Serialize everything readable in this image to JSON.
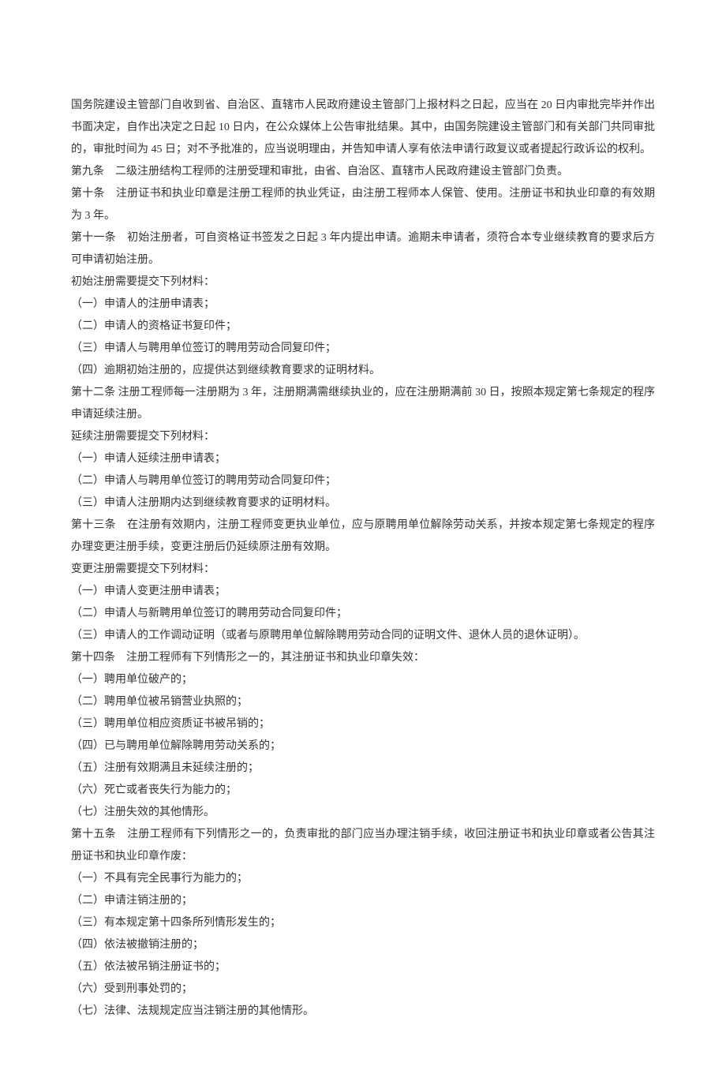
{
  "paragraphs": [
    "国务院建设主管部门自收到省、自治区、直辖市人民政府建设主管部门上报材料之日起，应当在 20 日内审批完毕并作出书面决定，自作出决定之日起 10 日内，在公众媒体上公告审批结果。其中，由国务院建设主管部门和有关部门共同审批的，审批时间为 45 日；对不予批准的，应当说明理由，并告知申请人享有依法申请行政复议或者提起行政诉讼的权利。",
    "第九条　二级注册结构工程师的注册受理和审批，由省、自治区、直辖市人民政府建设主管部门负责。",
    "第十条　注册证书和执业印章是注册工程师的执业凭证，由注册工程师本人保管、使用。注册证书和执业印章的有效期为 3 年。",
    "第十一条　初始注册者，可自资格证书签发之日起 3 年内提出申请。逾期未申请者，须符合本专业继续教育的要求后方可申请初始注册。",
    "初始注册需要提交下列材料：",
    "（一）申请人的注册申请表；",
    "（二）申请人的资格证书复印件；",
    "（三）申请人与聘用单位签订的聘用劳动合同复印件；",
    "（四）逾期初始注册的，应提供达到继续教育要求的证明材料。",
    "第十二条 注册工程师每一注册期为 3 年，注册期满需继续执业的，应在注册期满前 30 日，按照本规定第七条规定的程序申请延续注册。",
    "延续注册需要提交下列材料：",
    "（一）申请人延续注册申请表；",
    "（二）申请人与聘用单位签订的聘用劳动合同复印件；",
    "（三）申请人注册期内达到继续教育要求的证明材料。",
    "第十三条　在注册有效期内，注册工程师变更执业单位，应与原聘用单位解除劳动关系，并按本规定第七条规定的程序办理变更注册手续，变更注册后仍延续原注册有效期。",
    "变更注册需要提交下列材料：",
    "（一）申请人变更注册申请表；",
    "（二）申请人与新聘用单位签订的聘用劳动合同复印件；",
    "（三）申请人的工作调动证明（或者与原聘用单位解除聘用劳动合同的证明文件、退休人员的退休证明）。",
    "第十四条　注册工程师有下列情形之一的，其注册证书和执业印章失效：",
    "（一）聘用单位破产的；",
    "（二）聘用单位被吊销营业执照的；",
    "（三）聘用单位相应资质证书被吊销的；",
    "（四）已与聘用单位解除聘用劳动关系的；",
    "（五）注册有效期满且未延续注册的；",
    "（六）死亡或者丧失行为能力的；",
    "（七）注册失效的其他情形。",
    "第十五条　注册工程师有下列情形之一的，负责审批的部门应当办理注销手续，收回注册证书和执业印章或者公告其注册证书和执业印章作废：",
    "（一）不具有完全民事行为能力的；",
    "（二）申请注销注册的；",
    "（三）有本规定第十四条所列情形发生的；",
    "（四）依法被撤销注册的；",
    "（五）依法被吊销注册证书的；",
    "（六）受到刑事处罚的；",
    "（七）法律、法规规定应当注销注册的其他情形。"
  ]
}
